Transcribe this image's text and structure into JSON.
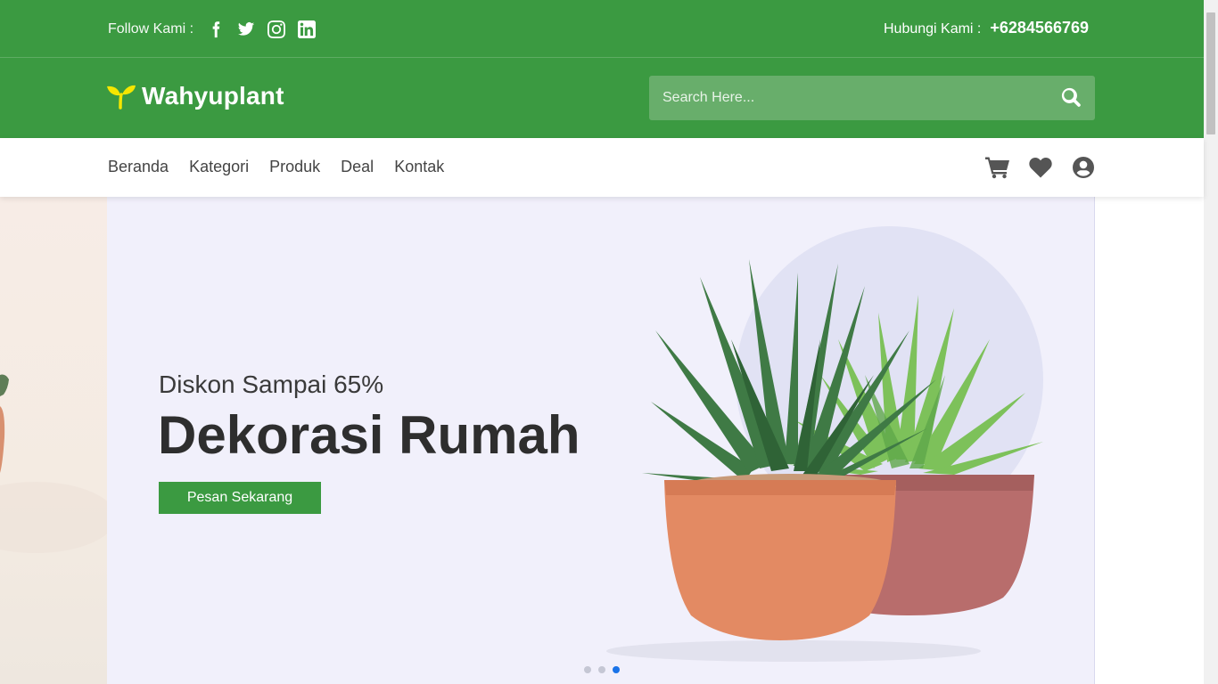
{
  "topbar": {
    "follow_label": "Follow Kami :",
    "social": [
      {
        "icon": "facebook-icon"
      },
      {
        "icon": "twitter-icon"
      },
      {
        "icon": "instagram-icon"
      },
      {
        "icon": "linkedin-icon"
      }
    ],
    "contact_label": "Hubungi Kami :",
    "phone": "+6284566769"
  },
  "header": {
    "brand_name": "Wahyuplant",
    "logo_icon": "sprout-icon",
    "search": {
      "placeholder": "Search Here...",
      "value": "",
      "icon": "search-icon"
    }
  },
  "nav": {
    "links": [
      "Beranda",
      "Kategori",
      "Produk",
      "Deal",
      "Kontak"
    ],
    "icons": [
      "cart-icon",
      "heart-icon",
      "user-icon"
    ]
  },
  "hero": {
    "subtitle": "Diskon Sampai 65%",
    "title": "Dekorasi Rumah",
    "cta_label": "Pesan Sekarang",
    "slides_total": 3,
    "active_slide": 3
  },
  "colors": {
    "brand_green": "#3b9a41",
    "search_bg": "#68ae6b",
    "hero_bg": "#f1f0fb",
    "active_dot": "#1a73e8"
  }
}
